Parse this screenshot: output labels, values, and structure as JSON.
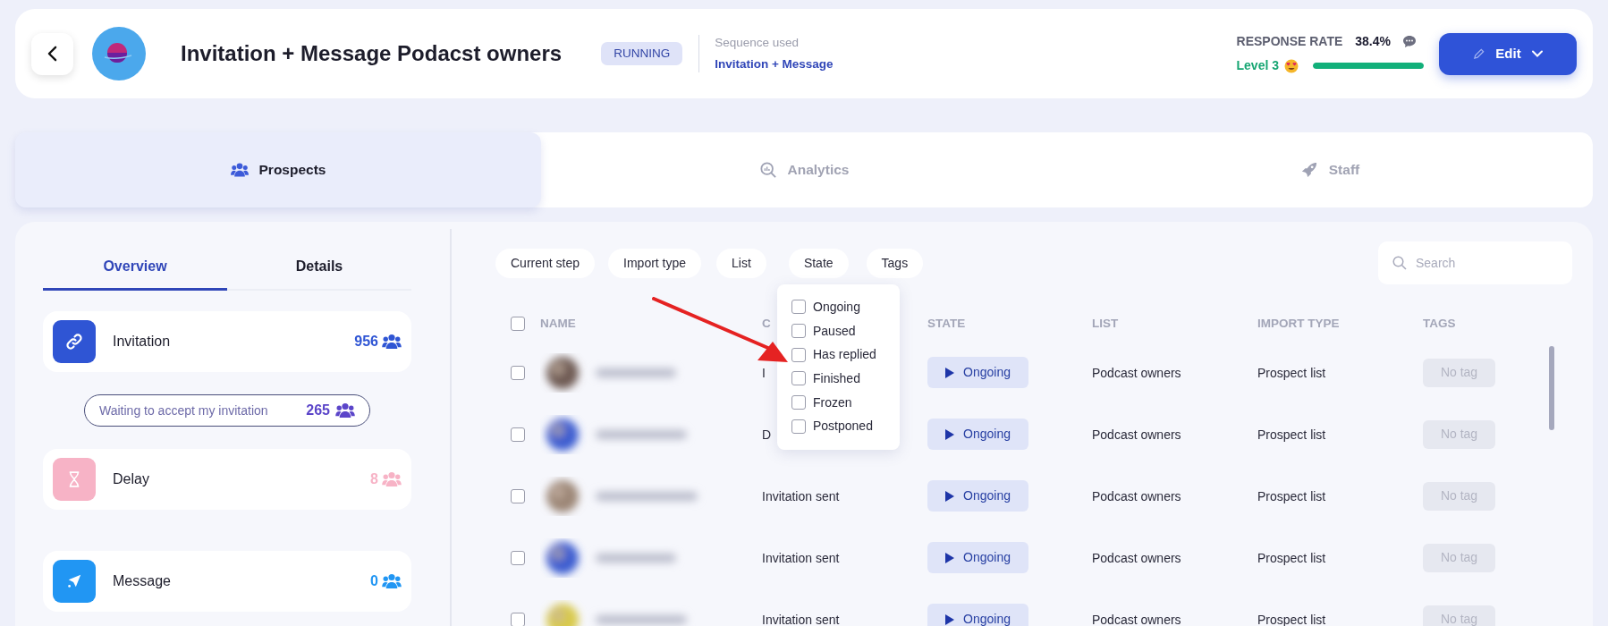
{
  "header": {
    "title": "Invitation + Message Podacst owners",
    "status": "RUNNING",
    "sequence_label": "Sequence used",
    "sequence_name": "Invitation + Message",
    "response_rate_label": "RESPONSE RATE",
    "response_rate": "38.4%",
    "level_label": "Level 3",
    "level": 1,
    "edit_button": "Edit"
  },
  "tabs": [
    {
      "label": "Prospects",
      "selected": true
    },
    {
      "label": "Analytics",
      "selected": false
    },
    {
      "label": "Staff",
      "selected": false
    }
  ],
  "view_tabs": [
    {
      "label": "Overview",
      "selected": true
    },
    {
      "label": "Details",
      "selected": false
    }
  ],
  "steps": [
    {
      "kind": "step",
      "label": "Invitation",
      "count": "956",
      "color": "#2f55d4"
    },
    {
      "kind": "waiting",
      "label": "Waiting to accept my invitation",
      "count": "265",
      "color": "#5b45c9"
    },
    {
      "kind": "step",
      "label": "Delay",
      "count": "8",
      "color": "#f7b3c6"
    },
    {
      "kind": "step",
      "label": "Message",
      "count": "0",
      "color": "#2196f3"
    }
  ],
  "filters": [
    "Current step",
    "Import type",
    "List",
    "State",
    "Tags"
  ],
  "search": {
    "placeholder": "Search"
  },
  "table": {
    "select_all_checked": false,
    "columns": [
      "NAME",
      "C",
      "STATE",
      "LIST",
      "IMPORT TYPE",
      "TAGS"
    ],
    "rows": [
      {
        "checked": false,
        "current_step": "I",
        "state": "Ongoing",
        "list": "Podcast owners",
        "import_type": "Prospect list",
        "tag": "No tag"
      },
      {
        "checked": false,
        "current_step": "D",
        "state": "Ongoing",
        "list": "Podcast owners",
        "import_type": "Prospect list",
        "tag": "No tag"
      },
      {
        "checked": false,
        "current_step": "Invitation sent",
        "state": "Ongoing",
        "list": "Podcast owners",
        "import_type": "Prospect list",
        "tag": "No tag"
      },
      {
        "checked": false,
        "current_step": "Invitation sent",
        "state": "Ongoing",
        "list": "Podcast owners",
        "import_type": "Prospect list",
        "tag": "No tag"
      },
      {
        "checked": false,
        "current_step": "Invitation sent",
        "state": "Ongoing",
        "list": "Podcast owners",
        "import_type": "Prospect list",
        "tag": "No tag"
      }
    ]
  },
  "state_menu": {
    "items": [
      {
        "label": "Ongoing",
        "checked": false
      },
      {
        "label": "Paused",
        "checked": false
      },
      {
        "label": "Has replied",
        "checked": false
      },
      {
        "label": "Finished",
        "checked": false
      },
      {
        "label": "Frozen",
        "checked": false
      },
      {
        "label": "Postponed",
        "checked": false
      }
    ]
  }
}
